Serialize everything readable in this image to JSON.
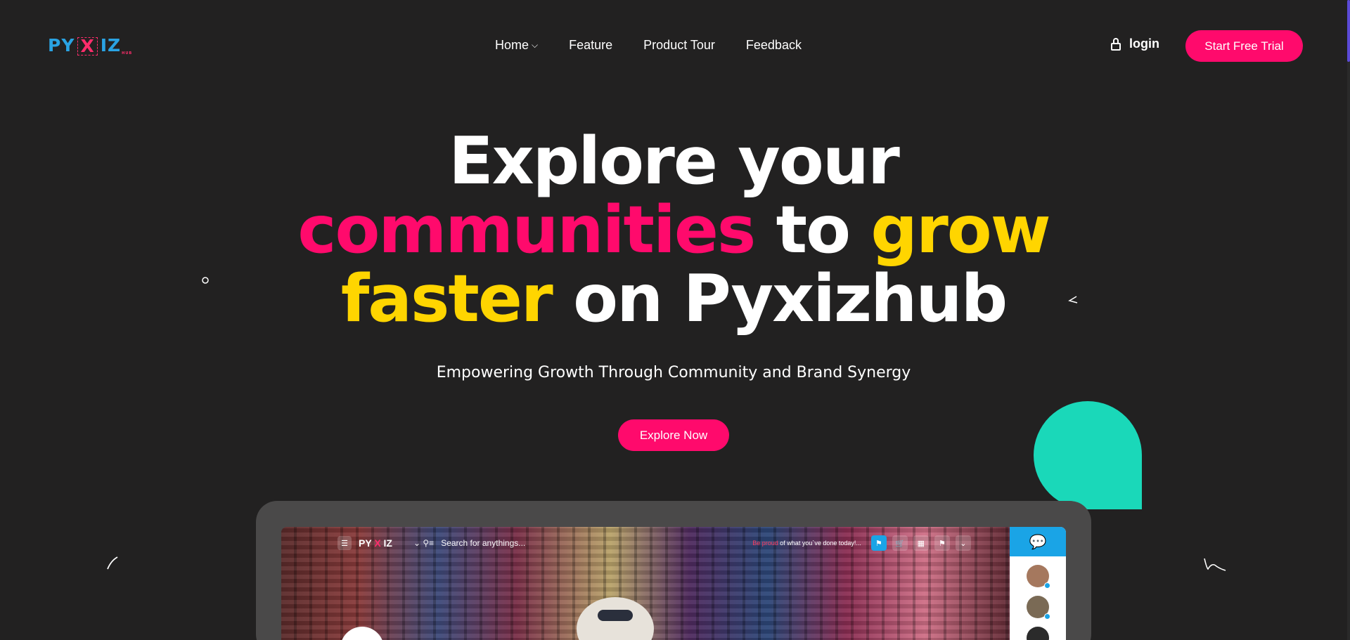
{
  "brand": {
    "logo_left": "PY",
    "logo_x": "X",
    "logo_right": "IZ",
    "logo_sub": "HUB"
  },
  "nav": {
    "items": [
      {
        "label": "Home",
        "has_dropdown": true
      },
      {
        "label": "Feature"
      },
      {
        "label": "Product Tour"
      },
      {
        "label": "Feedback"
      }
    ],
    "login_label": "login",
    "trial_label": "Start Free Trial"
  },
  "hero": {
    "line1": "Explore your",
    "line2_a": "communities",
    "line2_b": " to ",
    "line2_c": "grow",
    "line3_a": "faster",
    "line3_b": " on Pyxizhub",
    "subtitle": "Empowering Growth Through Community and Brand Synergy",
    "cta": "Explore Now"
  },
  "mock": {
    "logo_left": "PY ",
    "logo_x": "X",
    "logo_right": " IZ",
    "search_placeholder": "Search for anythings...",
    "proud_red": "Be proud",
    "proud_rest": " of what you`ve done today!..."
  },
  "colors": {
    "background": "#222121",
    "accent_pink": "#ff0a6c",
    "accent_yellow": "#ffd500",
    "accent_teal": "#1ad8b9",
    "accent_blue": "#1aa4e6"
  }
}
